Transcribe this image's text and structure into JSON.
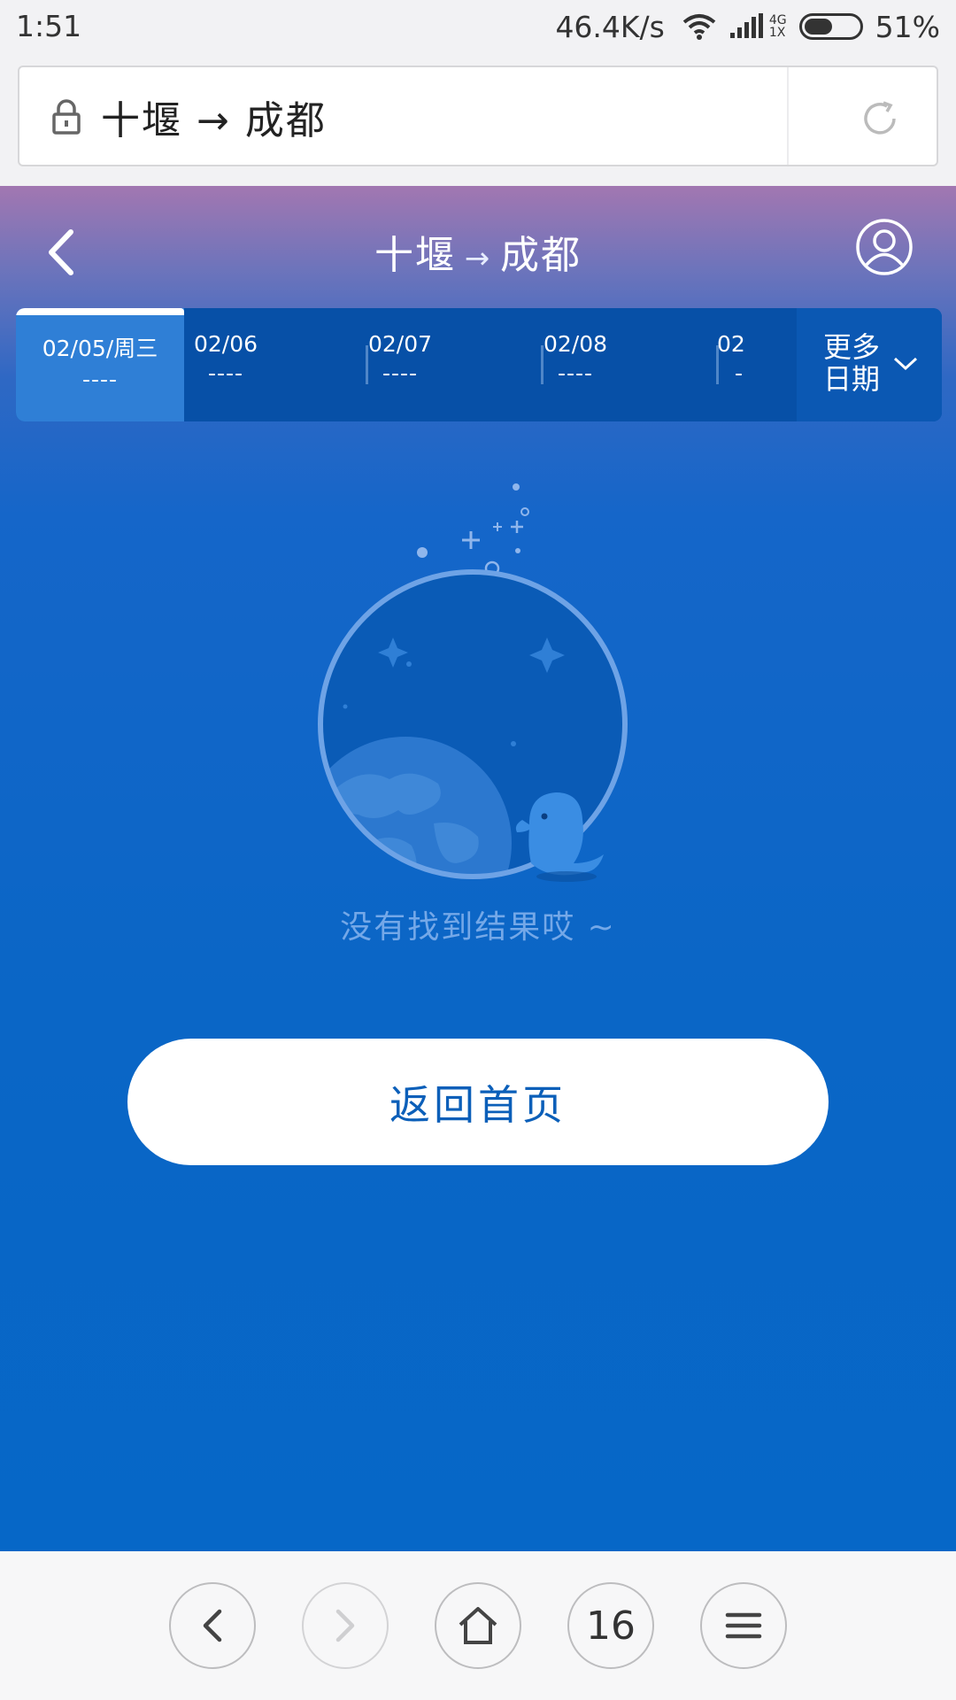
{
  "status_bar": {
    "time": "1:51",
    "net_speed": "46.4K/s",
    "signal_type_top": "4G",
    "signal_type_bottom": "1X",
    "battery_text": "51%",
    "battery_level": 0.51
  },
  "address_bar": {
    "url_text": "十堰 → 成都"
  },
  "header": {
    "from": "十堰",
    "to": "成都",
    "arrow": "→"
  },
  "date_tabs": [
    {
      "date": "02/05/周三",
      "price": "----"
    },
    {
      "date": "02/06",
      "price": "----"
    },
    {
      "date": "02/07",
      "price": "----"
    },
    {
      "date": "02/08",
      "price": "----"
    },
    {
      "date": "02",
      "price": "-"
    }
  ],
  "more_dates": {
    "line1": "更多",
    "line2": "日期"
  },
  "empty_state": {
    "message": "没有找到结果哎 ~"
  },
  "actions": {
    "home_label": "返回首页"
  },
  "bottom_nav": {
    "tab_count": "16"
  },
  "colors": {
    "accent": "#0667c7",
    "button_text": "#0b5fb9",
    "active_tab": "#2f7fd6"
  }
}
